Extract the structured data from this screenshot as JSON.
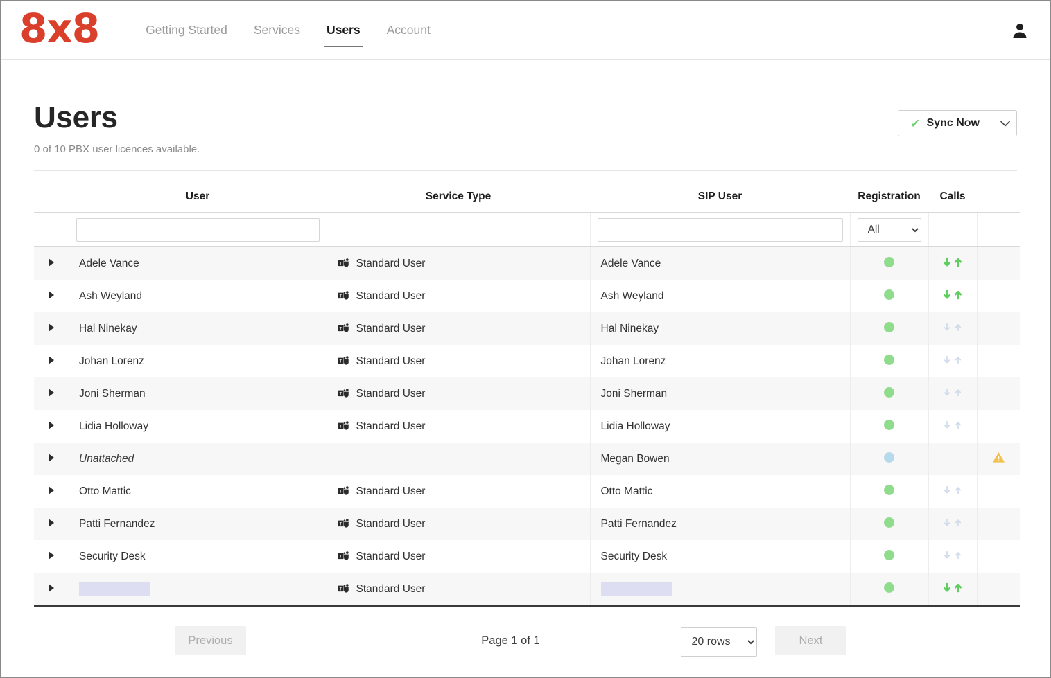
{
  "header": {
    "logo_text": "8x8",
    "nav": [
      {
        "label": "Getting Started",
        "active": false
      },
      {
        "label": "Services",
        "active": false
      },
      {
        "label": "Users",
        "active": true
      },
      {
        "label": "Account",
        "active": false
      }
    ],
    "account_icon": "user-icon"
  },
  "page": {
    "title": "Users",
    "subtitle": "0 of 10 PBX user licences available.",
    "sync_button": {
      "label": "Sync Now",
      "check_icon": "check-icon",
      "caret_icon": "chevron-down-icon"
    }
  },
  "table": {
    "columns": [
      "User",
      "Service Type",
      "SIP User",
      "Registration",
      "Calls"
    ],
    "filters": {
      "user_value": "",
      "user_placeholder": "",
      "sip_value": "",
      "sip_placeholder": "",
      "registration_value": "All",
      "registration_options": [
        "All"
      ]
    },
    "rows": [
      {
        "expand_icon": "caret-right-icon",
        "user": "Adele Vance",
        "user_redacted": false,
        "service_type": "Standard User",
        "service_icon": "teams-icon",
        "sip_user": "Adele Vance",
        "sip_redacted": false,
        "registration": "registered",
        "reg_color": "#8fdd8c",
        "calls": "active",
        "warning": false
      },
      {
        "expand_icon": "caret-right-icon",
        "user": "Ash Weyland",
        "user_redacted": false,
        "service_type": "Standard User",
        "service_icon": "teams-icon",
        "sip_user": "Ash Weyland",
        "sip_redacted": false,
        "registration": "registered",
        "reg_color": "#8fdd8c",
        "calls": "active",
        "warning": false
      },
      {
        "expand_icon": "caret-right-icon",
        "user": "Hal Ninekay",
        "user_redacted": false,
        "service_type": "Standard User",
        "service_icon": "teams-icon",
        "sip_user": "Hal Ninekay",
        "sip_redacted": false,
        "registration": "registered",
        "reg_color": "#8fdd8c",
        "calls": "inactive",
        "warning": false
      },
      {
        "expand_icon": "caret-right-icon",
        "user": "Johan Lorenz",
        "user_redacted": false,
        "service_type": "Standard User",
        "service_icon": "teams-icon",
        "sip_user": "Johan Lorenz",
        "sip_redacted": false,
        "registration": "registered",
        "reg_color": "#8fdd8c",
        "calls": "inactive",
        "warning": false
      },
      {
        "expand_icon": "caret-right-icon",
        "user": "Joni Sherman",
        "user_redacted": false,
        "service_type": "Standard User",
        "service_icon": "teams-icon",
        "sip_user": "Joni Sherman",
        "sip_redacted": false,
        "registration": "registered",
        "reg_color": "#8fdd8c",
        "calls": "inactive",
        "warning": false
      },
      {
        "expand_icon": "caret-right-icon",
        "user": "Lidia Holloway",
        "user_redacted": false,
        "service_type": "Standard User",
        "service_icon": "teams-icon",
        "sip_user": "Lidia Holloway",
        "sip_redacted": false,
        "registration": "registered",
        "reg_color": "#8fdd8c",
        "calls": "inactive",
        "warning": false
      },
      {
        "expand_icon": "caret-right-icon",
        "user": "Unattached",
        "user_italic": true,
        "user_redacted": false,
        "service_type": "",
        "service_icon": "",
        "sip_user": "Megan Bowen",
        "sip_redacted": false,
        "registration": "unregistered",
        "reg_color": "#b7d9ec",
        "calls": "none",
        "warning": true,
        "warning_icon": "warning-triangle-icon"
      },
      {
        "expand_icon": "caret-right-icon",
        "user": "Otto Mattic",
        "user_redacted": false,
        "service_type": "Standard User",
        "service_icon": "teams-icon",
        "sip_user": "Otto Mattic",
        "sip_redacted": false,
        "registration": "registered",
        "reg_color": "#8fdd8c",
        "calls": "inactive",
        "warning": false
      },
      {
        "expand_icon": "caret-right-icon",
        "user": "Patti Fernandez",
        "user_redacted": false,
        "service_type": "Standard User",
        "service_icon": "teams-icon",
        "sip_user": "Patti Fernandez",
        "sip_redacted": false,
        "registration": "registered",
        "reg_color": "#8fdd8c",
        "calls": "inactive",
        "warning": false
      },
      {
        "expand_icon": "caret-right-icon",
        "user": "Security Desk",
        "user_redacted": false,
        "service_type": "Standard User",
        "service_icon": "teams-icon",
        "sip_user": "Security Desk",
        "sip_redacted": false,
        "registration": "registered",
        "reg_color": "#8fdd8c",
        "calls": "inactive",
        "warning": false
      },
      {
        "expand_icon": "caret-right-icon",
        "user": "",
        "user_redacted": true,
        "service_type": "Standard User",
        "service_icon": "teams-icon",
        "sip_user": "",
        "sip_redacted": true,
        "registration": "registered",
        "reg_color": "#8fdd8c",
        "calls": "active",
        "warning": false
      }
    ]
  },
  "pagination": {
    "previous_label": "Previous",
    "page_label": "Page 1 of 1",
    "next_label": "Next",
    "rows_value": "20 rows",
    "rows_options": [
      "20 rows"
    ]
  },
  "colors": {
    "brand_red": "#d93f2b",
    "status_green": "#8fdd8c",
    "status_blue": "#b7d9ec",
    "warning_amber": "#f2c14a"
  }
}
